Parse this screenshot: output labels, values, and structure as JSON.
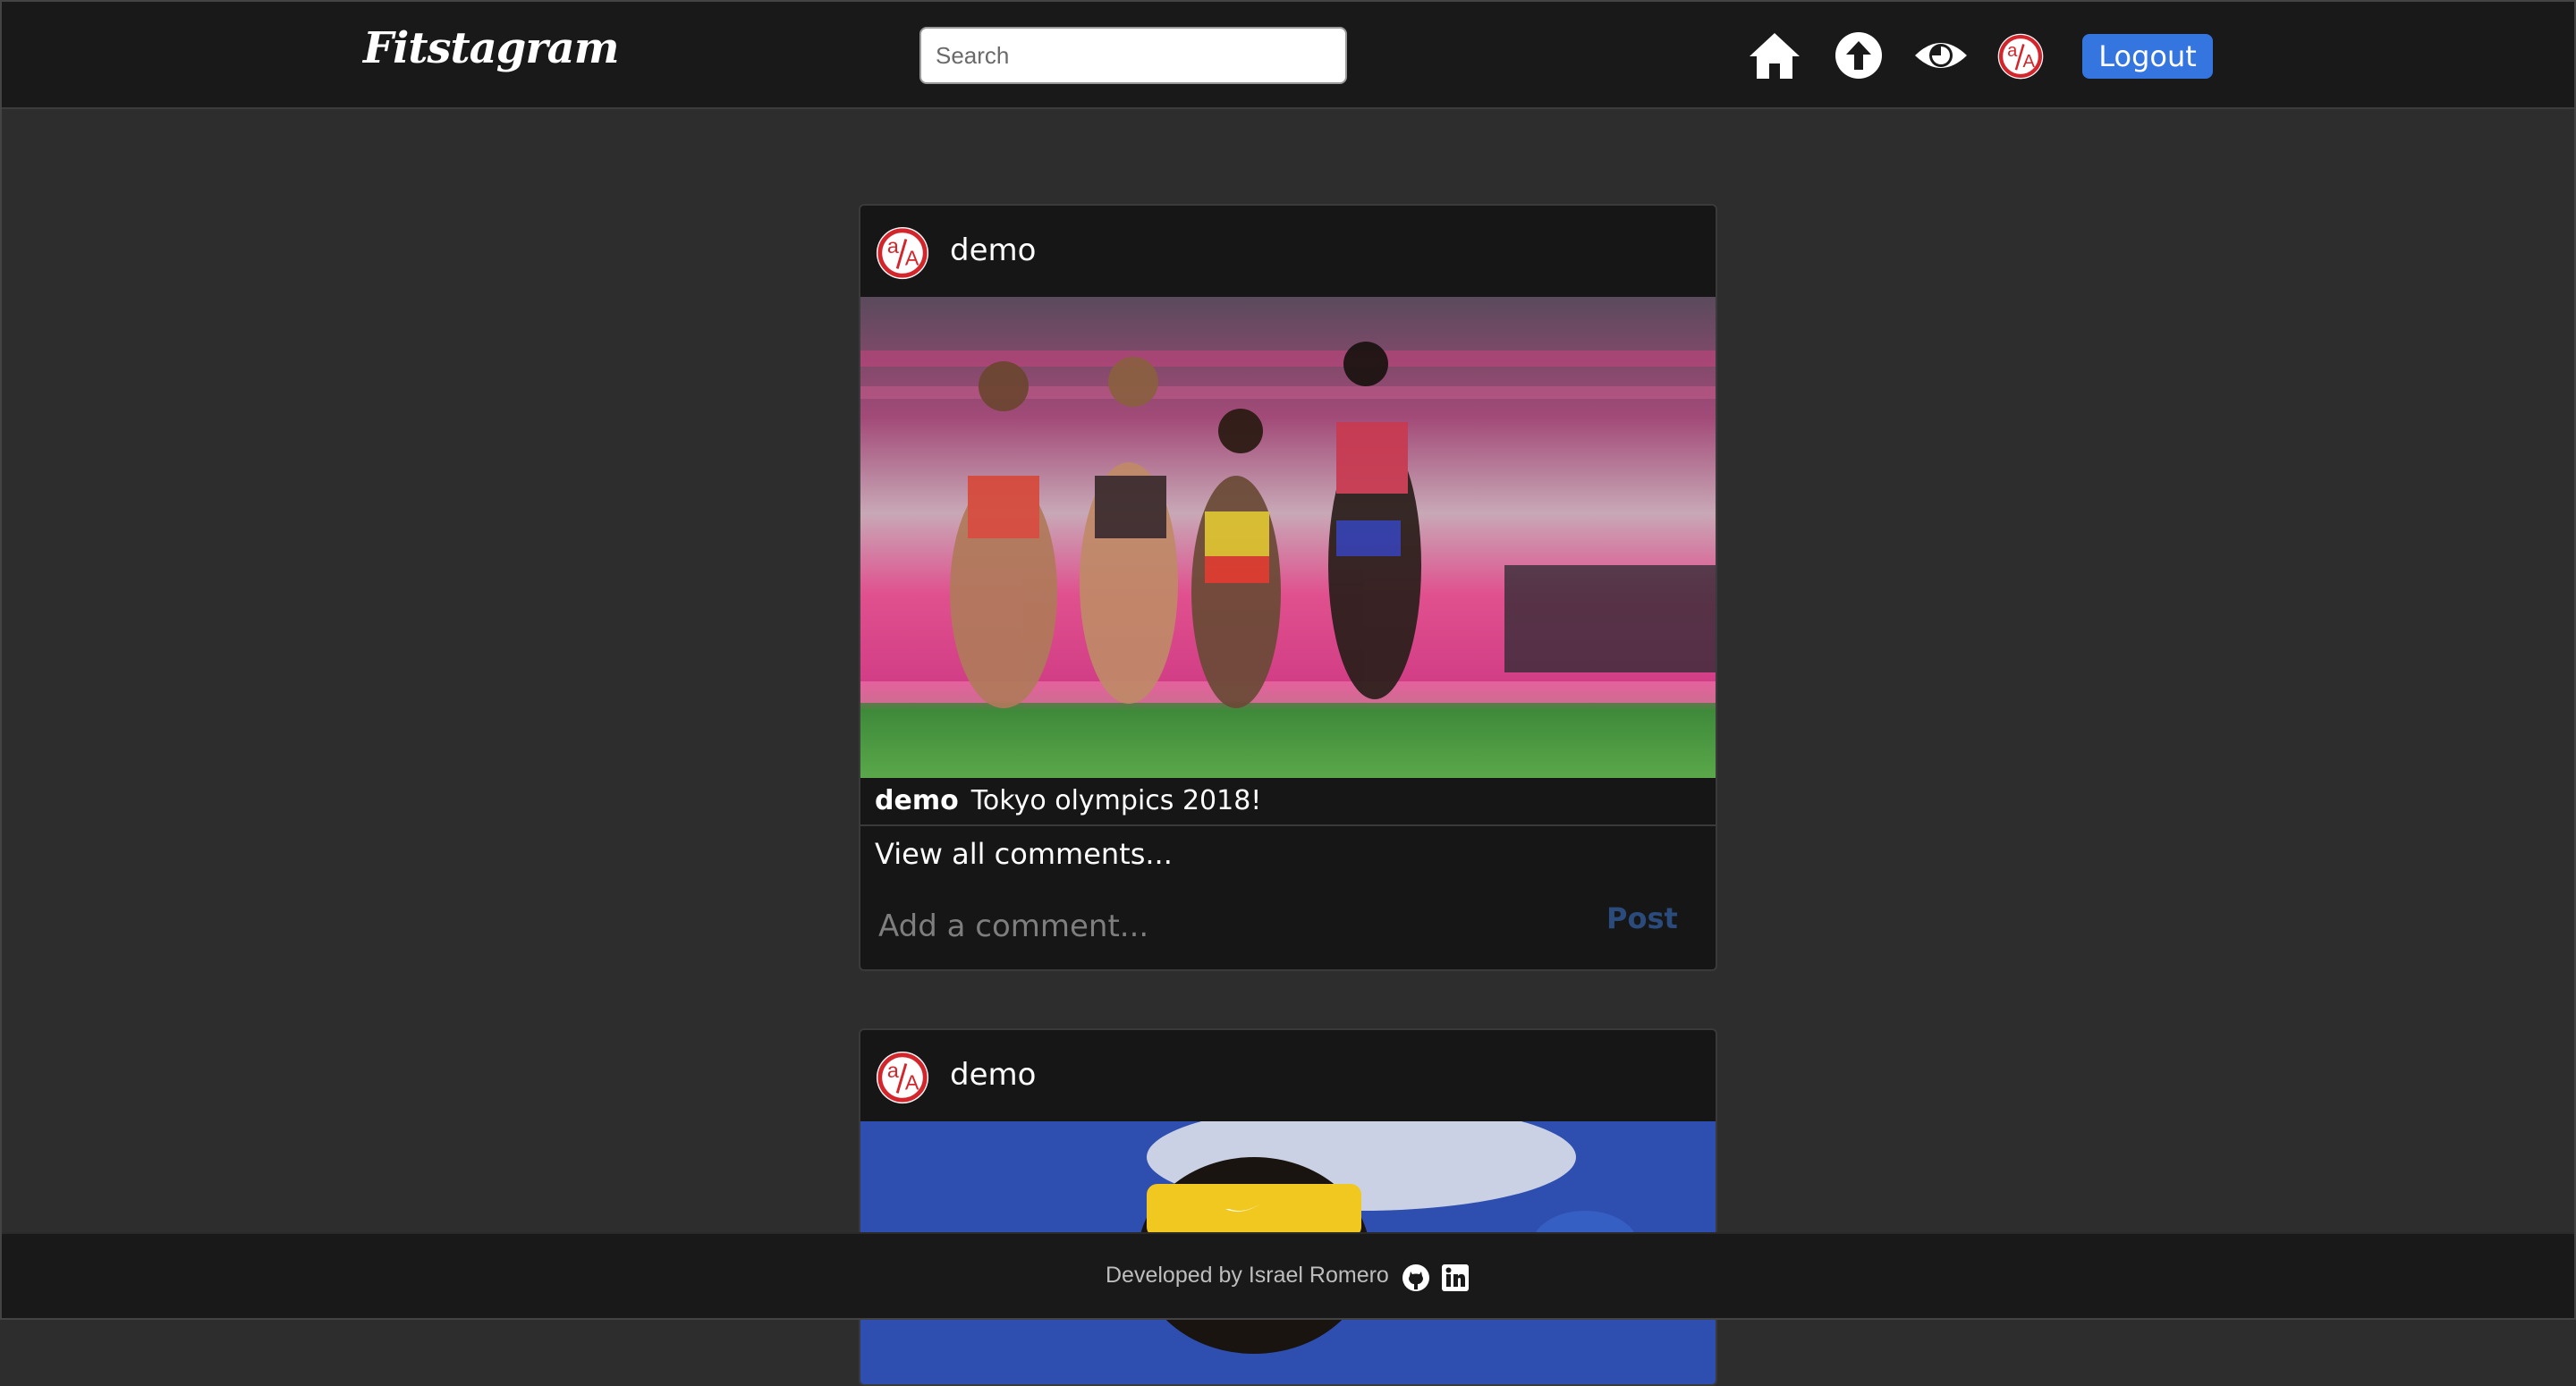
{
  "header": {
    "brand": "Fitstagram",
    "search_placeholder": "Search",
    "nav": {
      "home_icon": "home-icon",
      "upload_icon": "upload-arrow-icon",
      "explore_icon": "eye-icon",
      "profile_icon": "profile-avatar-icon"
    },
    "logout_label": "Logout"
  },
  "posts": [
    {
      "username": "demo",
      "photo": "track runners racing on pink track",
      "caption_user": "demo",
      "caption_text": "Tokyo olympics 2018!",
      "view_comments": "View all comments...",
      "comment_placeholder": "Add a comment...",
      "post_label": "Post"
    },
    {
      "username": "demo",
      "photo": "athlete wearing yellow headband",
      "caption_user": "",
      "caption_text": "",
      "view_comments": "",
      "comment_placeholder": "",
      "post_label": ""
    }
  ],
  "footer": {
    "text": "Developed by Israel Romero",
    "github_icon": "github-icon",
    "linkedin_icon": "linkedin-icon"
  },
  "colors": {
    "background": "#2d2d2d",
    "header": "#191919",
    "card": "#161616",
    "accent": "#3575e0",
    "post_button": "#2a4b7c",
    "avatar_red": "#d2262c"
  }
}
